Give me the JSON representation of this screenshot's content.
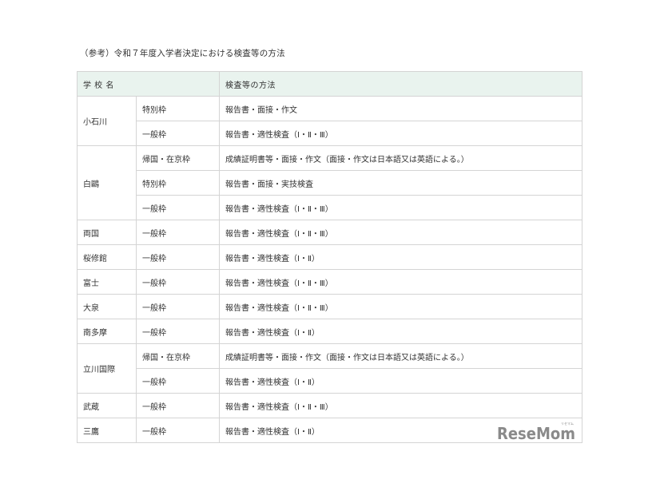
{
  "caption": "（参考）令和７年度入学者決定における検査等の方法",
  "table": {
    "headers": {
      "school": "学 校 名",
      "method": "検査等の方法"
    },
    "schools": [
      {
        "name": "小石川",
        "rows": [
          {
            "category": "特別枠",
            "method": "報告書・面接・作文"
          },
          {
            "category": "一般枠",
            "method": "報告書・適性検査（Ⅰ・Ⅱ・Ⅲ）"
          }
        ]
      },
      {
        "name": "白鷗",
        "rows": [
          {
            "category": "帰国・在京枠",
            "method": "成績証明書等・面接・作文（面接・作文は日本語又は英語による。）"
          },
          {
            "category": "特別枠",
            "method": "報告書・面接・実技検査"
          },
          {
            "category": "一般枠",
            "method": "報告書・適性検査（Ⅰ・Ⅱ・Ⅲ）"
          }
        ]
      },
      {
        "name": "両国",
        "rows": [
          {
            "category": "一般枠",
            "method": "報告書・適性検査（Ⅰ・Ⅱ・Ⅲ）"
          }
        ]
      },
      {
        "name": "桜修館",
        "rows": [
          {
            "category": "一般枠",
            "method": "報告書・適性検査（Ⅰ・Ⅱ）"
          }
        ]
      },
      {
        "name": "富士",
        "rows": [
          {
            "category": "一般枠",
            "method": "報告書・適性検査（Ⅰ・Ⅱ・Ⅲ）"
          }
        ]
      },
      {
        "name": "大泉",
        "rows": [
          {
            "category": "一般枠",
            "method": "報告書・適性検査（Ⅰ・Ⅱ・Ⅲ）"
          }
        ]
      },
      {
        "name": "南多摩",
        "rows": [
          {
            "category": "一般枠",
            "method": "報告書・適性検査（Ⅰ・Ⅱ）"
          }
        ]
      },
      {
        "name": "立川国際",
        "rows": [
          {
            "category": "帰国・在京枠",
            "method": "成績証明書等・面接・作文（面接・作文は日本語又は英語による。）"
          },
          {
            "category": "一般枠",
            "method": "報告書・適性検査（Ⅰ・Ⅱ）"
          }
        ]
      },
      {
        "name": "武蔵",
        "rows": [
          {
            "category": "一般枠",
            "method": "報告書・適性検査（Ⅰ・Ⅱ・Ⅲ）"
          }
        ]
      },
      {
        "name": "三鷹",
        "rows": [
          {
            "category": "一般枠",
            "method": "報告書・適性検査（Ⅰ・Ⅱ）"
          }
        ]
      }
    ]
  },
  "watermark": {
    "text": "ReseMom",
    "ruby": "リセマム"
  },
  "colors": {
    "header_bg": "#e9f3ee",
    "border": "#d4d4d4",
    "text": "#333333",
    "logo": "#8a8a8a"
  }
}
